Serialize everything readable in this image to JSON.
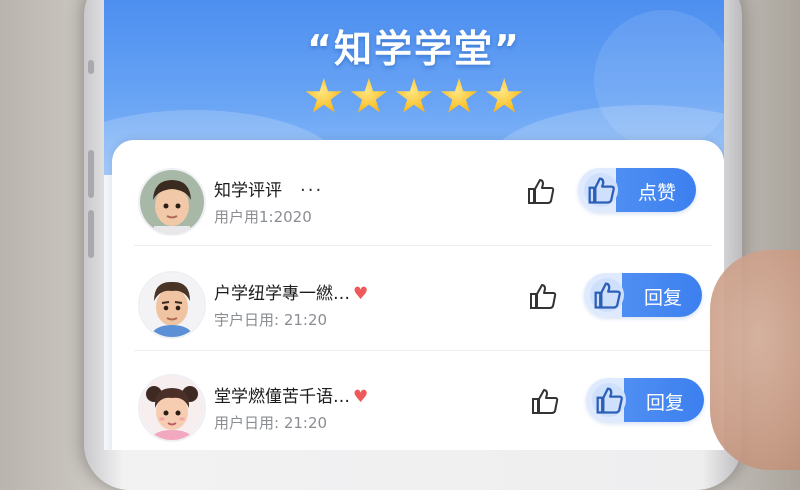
{
  "app": {
    "title": "“知学学堂”",
    "rating": 5
  },
  "comments": [
    {
      "name": "知学评评",
      "more": "···",
      "meta": "用户用1:2020",
      "action_label": "点赞",
      "avatar_icon": "boy-avatar",
      "has_heart": false
    },
    {
      "name": "户学纽学專一繎…",
      "more": "",
      "meta": "宇户日用: 21:20",
      "action_label": "回复",
      "avatar_icon": "man-avatar",
      "has_heart": true
    },
    {
      "name": "堂学燃僮苦千语…",
      "more": "",
      "meta": "用户日用: 21:20",
      "action_label": "回复",
      "avatar_icon": "girl-avatar",
      "has_heart": true
    }
  ],
  "colors": {
    "header": "#5a99f2",
    "accent": "#3c7fef",
    "heart": "#ee5a5a"
  }
}
